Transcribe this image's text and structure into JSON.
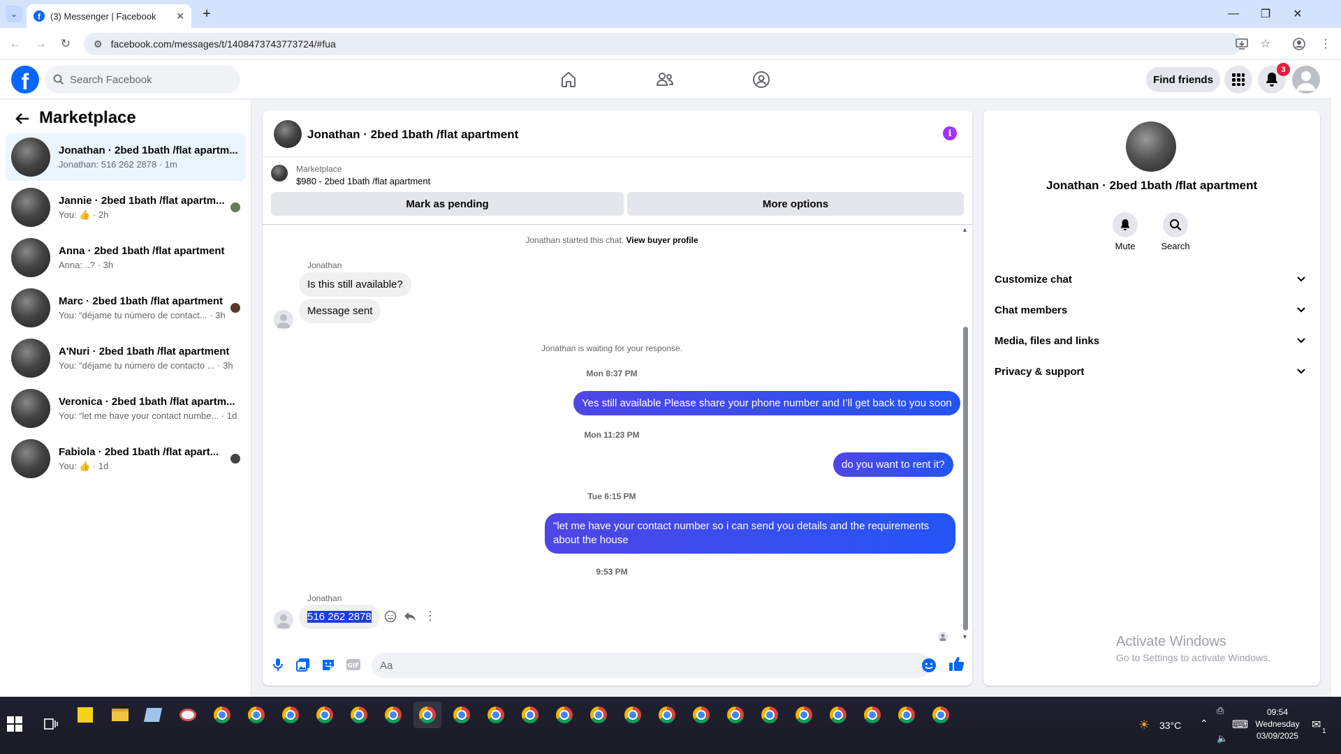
{
  "browser": {
    "tab_title": "(3) Messenger | Facebook",
    "url": "facebook.com/messages/t/1408473743773724/#fua"
  },
  "fb_header": {
    "logo_letter": "f",
    "search_placeholder": "Search Facebook",
    "find_friends": "Find friends",
    "notification_count": "3",
    "nav_icons": [
      "home-icon",
      "friends-icon",
      "groups-icon"
    ]
  },
  "sidebar": {
    "title": "Marketplace",
    "conversations": [
      {
        "name": "Jonathan · 2bed 1bath /flat apartm...",
        "preview": "Jonathan: 516 262 2878 · 1m",
        "active": true
      },
      {
        "name": "Jannie · 2bed 1bath /flat apartm...",
        "preview": "You: 👍 · 2h"
      },
      {
        "name": "Anna · 2bed 1bath /flat apartment",
        "preview": "Anna: ..? · 3h"
      },
      {
        "name": "Marc · 2bed 1bath /flat apartment",
        "preview": "You: “déjame tu número de contact... · 3h"
      },
      {
        "name": "A'Nuri · 2bed 1bath /flat apartment",
        "preview": "You: “déjame tu número de contacto ... · 3h"
      },
      {
        "name": "Veronica · 2bed 1bath /flat apartm...",
        "preview": "You: “let me have your contact numbe... · 1d"
      },
      {
        "name": "Fabiola · 2bed 1bath /flat apart...",
        "preview": "You: 👍 · 1d"
      }
    ]
  },
  "chat": {
    "title": "Jonathan · 2bed 1bath /flat apartment",
    "listing_label": "Marketplace",
    "listing_price_title": "$980 - 2bed 1bath /flat apartment",
    "mark_pending": "Mark as pending",
    "more_options": "More options",
    "started_text": "Jonathan started this chat.",
    "view_buyer_profile": "View buyer profile",
    "sender_name": "Jonathan",
    "msg_in_1": "Is this still available?",
    "msg_in_2": "Message sent",
    "waiting": "Jonathan is waiting for your response.",
    "ts_1": "Mon 8:37 PM",
    "msg_out_1": "Yes still available Please share your phone number and I’ll get back to you soon",
    "ts_2": "Mon 11:23 PM",
    "msg_out_2": "do you want to rent it?",
    "ts_3": "Tue 6:15 PM",
    "msg_out_3": "\"let me have your contact number so i can send you details and the requirements about the house",
    "ts_4": "9:53 PM",
    "sender_name_2": "Jonathan",
    "msg_in_3": "516 262 2878",
    "composer_placeholder": "Aa"
  },
  "right_panel": {
    "title": "Jonathan · 2bed 1bath /flat apartment",
    "mute": "Mute",
    "search": "Search",
    "sections": [
      "Customize chat",
      "Chat members",
      "Media, files and links",
      "Privacy & support"
    ],
    "activate_line1": "Activate Windows",
    "activate_line2": "Go to Settings to activate Windows."
  },
  "taskbar": {
    "weather": "33°C",
    "time": "09:54",
    "day": "Wednesday",
    "date": "03/09/2025",
    "notif_count": "1"
  },
  "colors": {
    "fb_blue": "#0866ff",
    "outgoing_bubble": "#4f46e5",
    "notification_red": "#e41e3f",
    "info_purple": "#a033ff"
  }
}
